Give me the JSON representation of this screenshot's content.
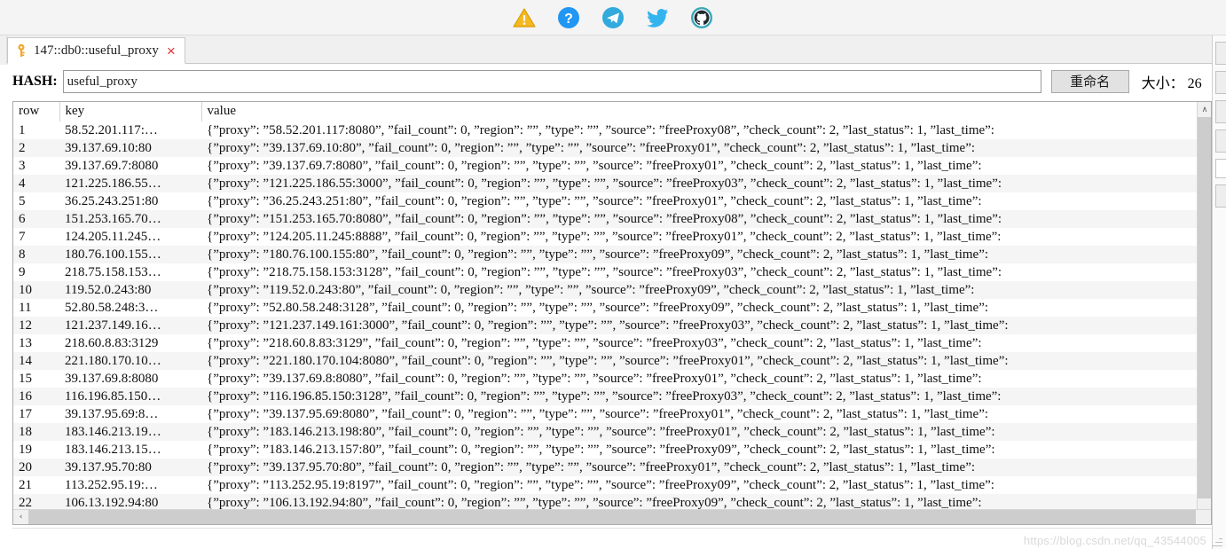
{
  "toolbar": {
    "icons": [
      {
        "name": "warning-icon",
        "title": "warning"
      },
      {
        "name": "help-icon",
        "title": "help"
      },
      {
        "name": "telegram-icon",
        "title": "telegram"
      },
      {
        "name": "twitter-icon",
        "title": "twitter"
      },
      {
        "name": "github-icon",
        "title": "github"
      }
    ],
    "colors": {
      "warning": "#f5b820",
      "help": "#2196f3",
      "telegram": "#33aadd",
      "twitter": "#34b4ef",
      "github": "#3aa7b8"
    }
  },
  "tab": {
    "icon": "key-icon",
    "label": "147::db0::useful_proxy",
    "close_label": "×"
  },
  "hashbar": {
    "label": "HASH:",
    "input_value": "useful_proxy",
    "input_placeholder": "",
    "rename_label": "重命名",
    "size_label": "大小： 26"
  },
  "table": {
    "columns": [
      "row",
      "key",
      "value"
    ],
    "sort_caret": "⌄",
    "rows": [
      {
        "row": "1",
        "key": "58.52.201.117:…",
        "value": "{”proxy”: ”58.52.201.117:8080”, ”fail_count”: 0, ”region”: ””, ”type”: ””, ”source”: ”freeProxy08”, ”check_count”: 2, ”last_status”: 1, ”last_time”:"
      },
      {
        "row": "2",
        "key": "39.137.69.10:80",
        "value": "{”proxy”: ”39.137.69.10:80”, ”fail_count”: 0, ”region”: ””, ”type”: ””, ”source”: ”freeProxy01”, ”check_count”: 2, ”last_status”: 1, ”last_time”:"
      },
      {
        "row": "3",
        "key": "39.137.69.7:8080",
        "value": "{”proxy”: ”39.137.69.7:8080”, ”fail_count”: 0, ”region”: ””, ”type”: ””, ”source”: ”freeProxy01”, ”check_count”: 2, ”last_status”: 1, ”last_time”:"
      },
      {
        "row": "4",
        "key": "121.225.186.55…",
        "value": "{”proxy”: ”121.225.186.55:3000”, ”fail_count”: 0, ”region”: ””, ”type”: ””, ”source”: ”freeProxy03”, ”check_count”: 2, ”last_status”: 1, ”last_time”:"
      },
      {
        "row": "5",
        "key": "36.25.243.251:80",
        "value": "{”proxy”: ”36.25.243.251:80”, ”fail_count”: 0, ”region”: ””, ”type”: ””, ”source”: ”freeProxy01”, ”check_count”: 2, ”last_status”: 1, ”last_time”:"
      },
      {
        "row": "6",
        "key": "151.253.165.70…",
        "value": "{”proxy”: ”151.253.165.70:8080”, ”fail_count”: 0, ”region”: ””, ”type”: ””, ”source”: ”freeProxy08”, ”check_count”: 2, ”last_status”: 1, ”last_time”:"
      },
      {
        "row": "7",
        "key": "124.205.11.245…",
        "value": "{”proxy”: ”124.205.11.245:8888”, ”fail_count”: 0, ”region”: ””, ”type”: ””, ”source”: ”freeProxy01”, ”check_count”: 2, ”last_status”: 1, ”last_time”:"
      },
      {
        "row": "8",
        "key": "180.76.100.155…",
        "value": "{”proxy”: ”180.76.100.155:80”, ”fail_count”: 0, ”region”: ””, ”type”: ””, ”source”: ”freeProxy09”, ”check_count”: 2, ”last_status”: 1, ”last_time”:"
      },
      {
        "row": "9",
        "key": "218.75.158.153…",
        "value": "{”proxy”: ”218.75.158.153:3128”, ”fail_count”: 0, ”region”: ””, ”type”: ””, ”source”: ”freeProxy03”, ”check_count”: 2, ”last_status”: 1, ”last_time”:"
      },
      {
        "row": "10",
        "key": "119.52.0.243:80",
        "value": "{”proxy”: ”119.52.0.243:80”, ”fail_count”: 0, ”region”: ””, ”type”: ””, ”source”: ”freeProxy09”, ”check_count”: 2, ”last_status”: 1, ”last_time”:"
      },
      {
        "row": "11",
        "key": "52.80.58.248:3…",
        "value": "{”proxy”: ”52.80.58.248:3128”, ”fail_count”: 0, ”region”: ””, ”type”: ””, ”source”: ”freeProxy09”, ”check_count”: 2, ”last_status”: 1, ”last_time”:"
      },
      {
        "row": "12",
        "key": "121.237.149.16…",
        "value": "{”proxy”: ”121.237.149.161:3000”, ”fail_count”: 0, ”region”: ””, ”type”: ””, ”source”: ”freeProxy03”, ”check_count”: 2, ”last_status”: 1, ”last_time”:"
      },
      {
        "row": "13",
        "key": "218.60.8.83:3129",
        "value": "{”proxy”: ”218.60.8.83:3129”, ”fail_count”: 0, ”region”: ””, ”type”: ””, ”source”: ”freeProxy03”, ”check_count”: 2, ”last_status”: 1, ”last_time”:"
      },
      {
        "row": "14",
        "key": "221.180.170.10…",
        "value": "{”proxy”: ”221.180.170.104:8080”, ”fail_count”: 0, ”region”: ””, ”type”: ””, ”source”: ”freeProxy01”, ”check_count”: 2, ”last_status”: 1, ”last_time”:"
      },
      {
        "row": "15",
        "key": "39.137.69.8:8080",
        "value": "{”proxy”: ”39.137.69.8:8080”, ”fail_count”: 0, ”region”: ””, ”type”: ””, ”source”: ”freeProxy01”, ”check_count”: 2, ”last_status”: 1, ”last_time”:"
      },
      {
        "row": "16",
        "key": "116.196.85.150…",
        "value": "{”proxy”: ”116.196.85.150:3128”, ”fail_count”: 0, ”region”: ””, ”type”: ””, ”source”: ”freeProxy03”, ”check_count”: 2, ”last_status”: 1, ”last_time”:"
      },
      {
        "row": "17",
        "key": "39.137.95.69:8…",
        "value": "{”proxy”: ”39.137.95.69:8080”, ”fail_count”: 0, ”region”: ””, ”type”: ””, ”source”: ”freeProxy01”, ”check_count”: 2, ”last_status”: 1, ”last_time”:"
      },
      {
        "row": "18",
        "key": "183.146.213.19…",
        "value": "{”proxy”: ”183.146.213.198:80”, ”fail_count”: 0, ”region”: ””, ”type”: ””, ”source”: ”freeProxy01”, ”check_count”: 2, ”last_status”: 1, ”last_time”:"
      },
      {
        "row": "19",
        "key": "183.146.213.15…",
        "value": "{”proxy”: ”183.146.213.157:80”, ”fail_count”: 0, ”region”: ””, ”type”: ””, ”source”: ”freeProxy09”, ”check_count”: 2, ”last_status”: 1, ”last_time”:"
      },
      {
        "row": "20",
        "key": "39.137.95.70:80",
        "value": "{”proxy”: ”39.137.95.70:80”, ”fail_count”: 0, ”region”: ””, ”type”: ””, ”source”: ”freeProxy01”, ”check_count”: 2, ”last_status”: 1, ”last_time”:"
      },
      {
        "row": "21",
        "key": "113.252.95.19:…",
        "value": "{”proxy”: ”113.252.95.19:8197”, ”fail_count”: 0, ”region”: ””, ”type”: ””, ”source”: ”freeProxy09”, ”check_count”: 2, ”last_status”: 1, ”last_time”:"
      },
      {
        "row": "22",
        "key": "106.13.192.94:80",
        "value": "{”proxy”: ”106.13.192.94:80”, ”fail_count”: 0, ”region”: ””, ”type”: ””, ”source”: ”freeProxy09”, ”check_count”: 2, ”last_status”: 1, ”last_time”:"
      }
    ]
  },
  "scrollbars": {
    "v_up_arrow": "∧",
    "h_left_arrow": "‹"
  },
  "watermark": "https://blog.csdn.net/qq_43544005"
}
